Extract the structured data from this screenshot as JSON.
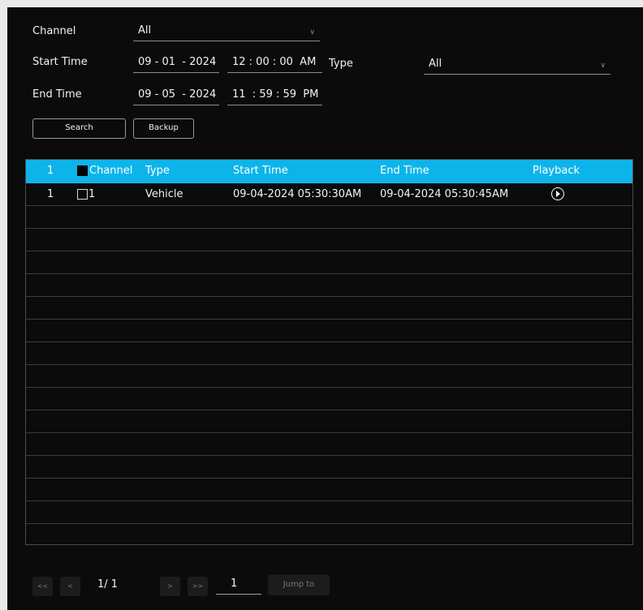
{
  "filters": {
    "channel_label": "Channel",
    "channel_value": "All",
    "start_time_label": "Start Time",
    "start_date": "09 - 01  - 2024",
    "start_time": "12 : 00 : 00  AM",
    "type_label": "Type",
    "type_value": "All",
    "end_time_label": "End Time",
    "end_date": "09 - 05  - 2024",
    "end_time": "11  : 59 : 59  PM"
  },
  "buttons": {
    "search": "Search",
    "backup": "Backup"
  },
  "table": {
    "headers": {
      "index": "1",
      "channel": "Channel",
      "type": "Type",
      "start_time": "Start Time",
      "end_time": "End Time",
      "playback": "Playback"
    },
    "rows": [
      {
        "index": "1",
        "channel": "1",
        "type": "Vehicle",
        "start_time": "09-04-2024 05:30:30AM",
        "end_time": "09-04-2024 05:30:45AM"
      }
    ]
  },
  "pagination": {
    "first": "<<",
    "prev": "<",
    "page_text": "1/  1",
    "next": ">",
    "last": ">>",
    "jump_value": "1",
    "jump_label": "Jump to"
  },
  "colors": {
    "header_bg": "#0db4ea",
    "panel_bg": "#0b0b0b"
  }
}
